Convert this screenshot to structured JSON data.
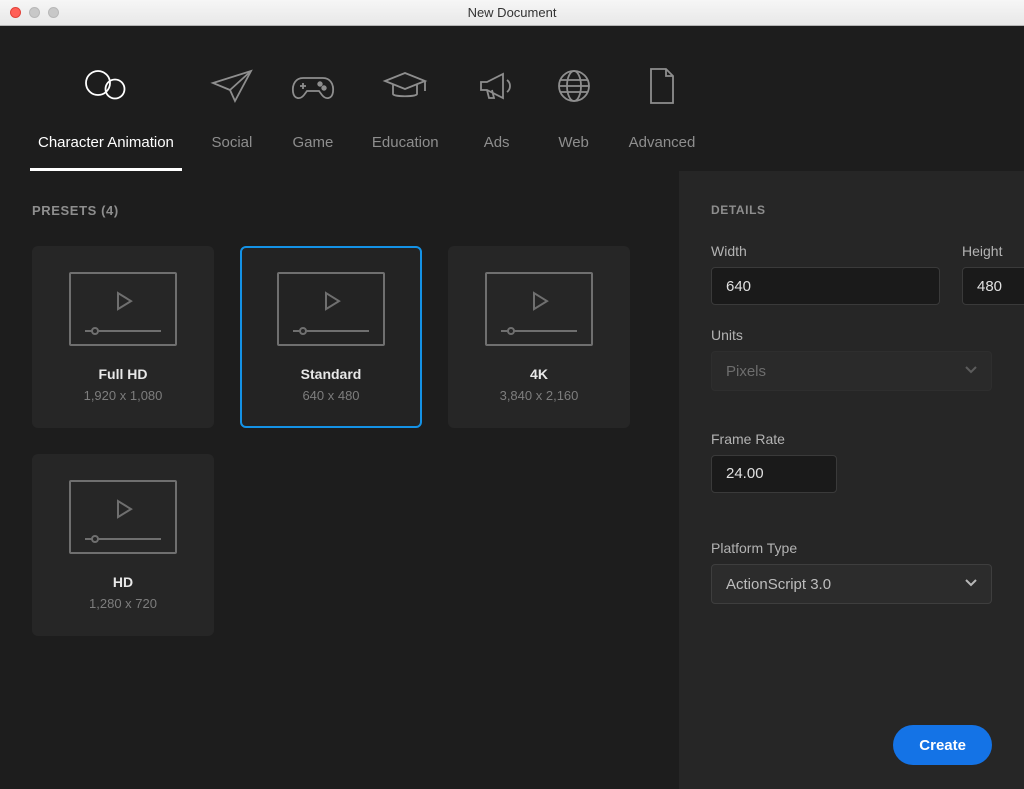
{
  "window": {
    "title": "New Document"
  },
  "tabs": [
    {
      "label": "Character Animation",
      "icon": "character-animation-icon"
    },
    {
      "label": "Social",
      "icon": "paper-plane-icon"
    },
    {
      "label": "Game",
      "icon": "game-controller-icon"
    },
    {
      "label": "Education",
      "icon": "graduation-cap-icon"
    },
    {
      "label": "Ads",
      "icon": "megaphone-icon"
    },
    {
      "label": "Web",
      "icon": "globe-icon"
    },
    {
      "label": "Advanced",
      "icon": "document-icon"
    }
  ],
  "active_tab_index": 0,
  "presets": {
    "header": "PRESETS (4)",
    "items": [
      {
        "name": "Full HD",
        "sub": "1,920 x 1,080"
      },
      {
        "name": "Standard",
        "sub": "640 x 480"
      },
      {
        "name": "4K",
        "sub": "3,840 x 2,160"
      },
      {
        "name": "HD",
        "sub": "1,280 x 720"
      }
    ],
    "selected_index": 1
  },
  "details": {
    "header": "DETAILS",
    "labels": {
      "width": "Width",
      "height": "Height",
      "units": "Units",
      "frame_rate": "Frame Rate",
      "platform": "Platform Type"
    },
    "values": {
      "width": "640",
      "height": "480",
      "units": "Pixels",
      "frame_rate": "24.00",
      "platform": "ActionScript 3.0"
    }
  },
  "buttons": {
    "create": "Create"
  }
}
